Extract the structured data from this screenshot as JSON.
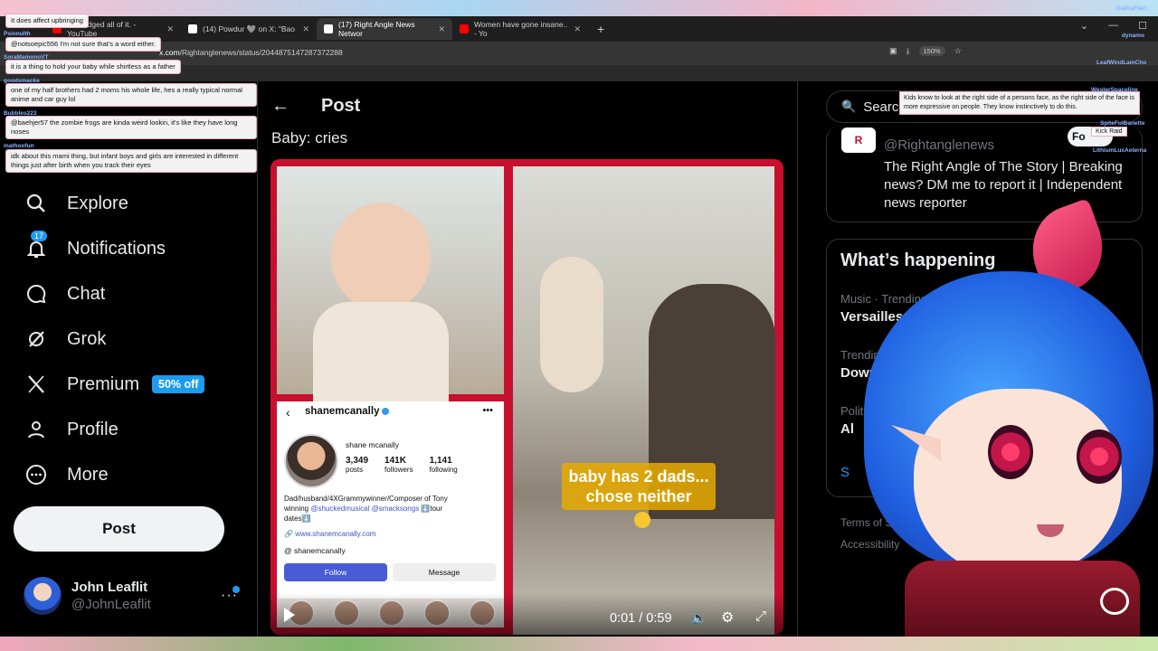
{
  "browser": {
    "tabs": [
      {
        "title": "He dodged all of it. - YouTube",
        "favicon_color": "#ff0000",
        "active": false
      },
      {
        "title": "(14) Powdur 🩶 on X: \"Bao",
        "favicon_color": "#ffffff",
        "active": false
      },
      {
        "title": "(17) Right Angle News Networ",
        "favicon_color": "#ffffff",
        "active": true
      },
      {
        "title": "Women have gone insane.. - Yo",
        "favicon_color": "#ff0000",
        "active": false
      }
    ],
    "new_tab": "+",
    "url_domain": "x.com",
    "url_path": "/Rightanglenews/status/2044875147287372288",
    "zoom": "150%"
  },
  "nav": {
    "items": [
      {
        "label": "Explore",
        "icon": "search-icon"
      },
      {
        "label": "Notifications",
        "icon": "bell-icon",
        "badge": "17"
      },
      {
        "label": "Chat",
        "icon": "chat-bubble-icon"
      },
      {
        "label": "Grok",
        "icon": "grok-icon"
      },
      {
        "label": "Premium",
        "icon": "x-logo-icon",
        "promo": "50% off"
      },
      {
        "label": "Profile",
        "icon": "person-icon"
      },
      {
        "label": "More",
        "icon": "more-circle-icon"
      }
    ],
    "post_button": "Post"
  },
  "account": {
    "name": "John Leaflit",
    "handle": "@JohnLeaflit",
    "more": "···"
  },
  "post": {
    "header": "Post",
    "back": "←",
    "text": "Baby: cries",
    "video": {
      "caption": "baby has 2 dads... chose neither",
      "time": "0:01 / 0:59",
      "instagram": {
        "username": "shanemcanally",
        "display_name": "shane mcanally",
        "posts": "3,349",
        "posts_label": "posts",
        "followers": "141K",
        "followers_label": "followers",
        "following": "1,141",
        "following_label": "following",
        "bio_1": "Dad/husband/4XGrammywinner/Composer of Tony",
        "bio_2a": "winning ",
        "bio_2_links": "@shuckedmusical @smacksongs",
        "bio_2b": " ⬇️tour",
        "bio_3": "dates⬇️",
        "website": "www.shanemcanally.com",
        "threads": "shanemcanally",
        "follow_btn": "Follow",
        "message_btn": "Message"
      }
    }
  },
  "sidebar": {
    "search_placeholder": "Search",
    "profile": {
      "logo_text": "R",
      "handle": "@Rightanglenews",
      "follow": "Fo",
      "bio": "The Right Angle of The Story | Breaking news? DM me to report it | Independent news reporter"
    },
    "whats_happening": {
      "title": "What’s happening",
      "trends": [
        {
          "meta": "Music · Trending",
          "name": "Versailles"
        },
        {
          "meta": "Trending",
          "name": "Downing"
        },
        {
          "meta": "Politi",
          "name": "Al"
        },
        {
          "meta": "",
          "name": "S"
        }
      ],
      "footer_1": "Terms of S",
      "footer_2": "Accessibility"
    }
  },
  "chat_overlay": {
    "messages": [
      {
        "user": "",
        "text": "It does affect upbringing"
      },
      {
        "user": "Psionulth",
        "text": "@notsoepic556 I'm not sure that's a word either."
      },
      {
        "user": "SoraMamonoVT",
        "text": "it is a thing to hold your baby while shirtless as a father"
      },
      {
        "user": "goodsmacke",
        "text": "one of my half brothers had 2 moms his whole life, hes a really typical normal anime and car guy lol"
      },
      {
        "user": "Bubbles223",
        "text": "@baehjer57 the zombie frogs are kinda weird lookin, it's like they have long noses"
      },
      {
        "user": "mathoofun",
        "text": "idk about this mami thing, but infant boys and girls are interested in different things just after birth when you track their eyes"
      }
    ],
    "right_message": "Kids know to look at the right side of a persons face, as the right side of the face is more expressive on people. They know instinctively to do this.",
    "kick_raid": "Kick Raid",
    "corner_names": [
      "DakkaFlert",
      "dynamo",
      "LeafWindLamCho",
      "WesterSpaceline",
      "SpiteFulBanette",
      "LithiumLuxAeterna"
    ]
  },
  "colors": {
    "x_blue": "#1d9bf0",
    "video_border": "#c8102e"
  }
}
